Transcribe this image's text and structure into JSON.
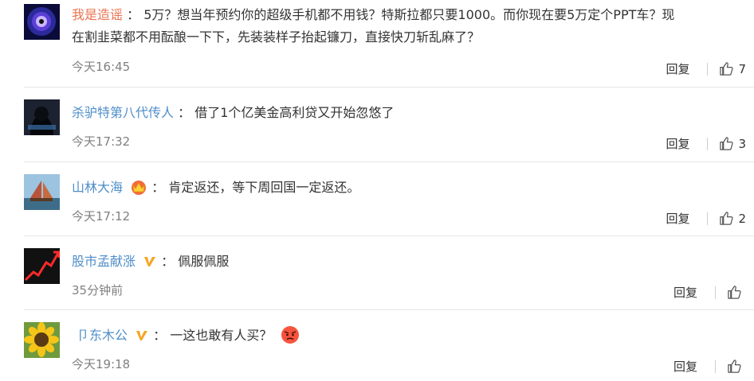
{
  "comments": [
    {
      "username": "我是造谣",
      "separator": "：",
      "text_line1": "5万？想当年预约你的超级手机都不用钱？特斯拉都只要1000。而你现在要5万定个PPT车？现",
      "text_line2": "在割韭菜都不用酝酿一下下，先装装样子抬起镰刀，直接快刀斩乱麻了？",
      "time": "今天16:45",
      "reply_label": "回复",
      "likes": "7"
    },
    {
      "username": "杀驴特第八代传人",
      "separator": "：",
      "text_line1": "借了1个亿美金高利贷又开始忽悠了",
      "time": "今天17:32",
      "reply_label": "回复",
      "likes": "3"
    },
    {
      "username": "山林大海",
      "separator": "：",
      "text_line1": "肯定返还，等下周回国一定返还。",
      "time": "今天17:12",
      "reply_label": "回复",
      "likes": "2",
      "badge_icon": "crown-vip-icon"
    },
    {
      "username": "股市孟献涨",
      "separator": "：",
      "text_line1": "佩服佩服",
      "time": "35分钟前",
      "reply_label": "回复",
      "likes": "",
      "badge_icon": "verified-v-icon"
    },
    {
      "username": "卩东木公",
      "separator": "：",
      "text_line1": "一这也敢有人买？",
      "time": "今天19:18",
      "reply_label": "回复",
      "likes": "",
      "badge_icon": "verified-v-icon",
      "emoji_icon": "angry-face-emoji"
    }
  ],
  "colors": {
    "username_orange": "#eb7350",
    "username_blue": "#4f8ec9",
    "badge_gold": "#f5a623",
    "time_gray": "#808080"
  }
}
